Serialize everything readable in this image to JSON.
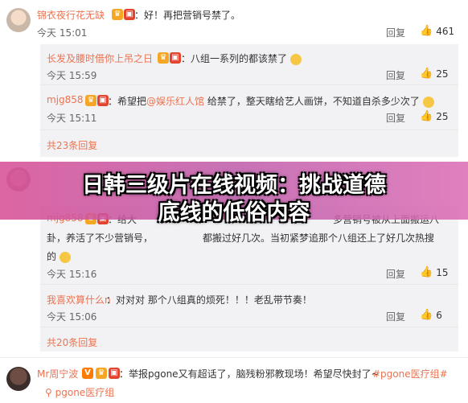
{
  "comments": [
    {
      "username": "锦衣夜行花无缺",
      "text": "：好！再把营销号禁了。",
      "time": "今天 15:01",
      "reply_label": "回复",
      "likes": "461"
    },
    {
      "username": "Mr周宁波",
      "text_prefix": "：举报pgone又有超话了，脑残粉邪教现场！希望尽快封了~",
      "link1": "#pgone医疗组#",
      "link2": "pgone医疗组"
    }
  ],
  "sub_replies_1": [
    {
      "username": "长发及腰时借你上吊之日",
      "text": "：八组一系列的都该禁了",
      "time": "今天 15:59",
      "likes": "25"
    },
    {
      "username": "mjg858",
      "text_prefix": "：希望把",
      "link": "@娱乐红人馆",
      "text_suffix": " 给禁了，整天瞎给艺人画饼，不知道自杀多少次了",
      "time": "今天 15:11",
      "likes": "25"
    }
  ],
  "more_replies_1": "共23条回复",
  "sub_replies_2": [
    {
      "username": "mjg858",
      "text_line1": "：给大",
      "text_line1_end": "多营销号被从上面搬运八",
      "text_line2_start": "卦，养活了不少营销号，",
      "text_line2_end": "都搬过好几次。当初紧梦追那个八组还上了好几次热搜",
      "text_line3": "的",
      "time": "今天 15:16",
      "likes": "15"
    },
    {
      "username": "我喜欢算什么n",
      "text": "：对对对 那个八组真的烦死！！！老乱带节奏！",
      "time": "今天 15:06",
      "likes": "6"
    }
  ],
  "more_replies_2": "共20条回复",
  "reply_label": "回复",
  "banner": {
    "line1": "日韩三级片在线视频：挑战道德",
    "line2": "底线的低俗内容"
  },
  "colors": {
    "username": "#eb7350",
    "sub_bg": "#f2f2f5",
    "banner": "#d35096"
  }
}
